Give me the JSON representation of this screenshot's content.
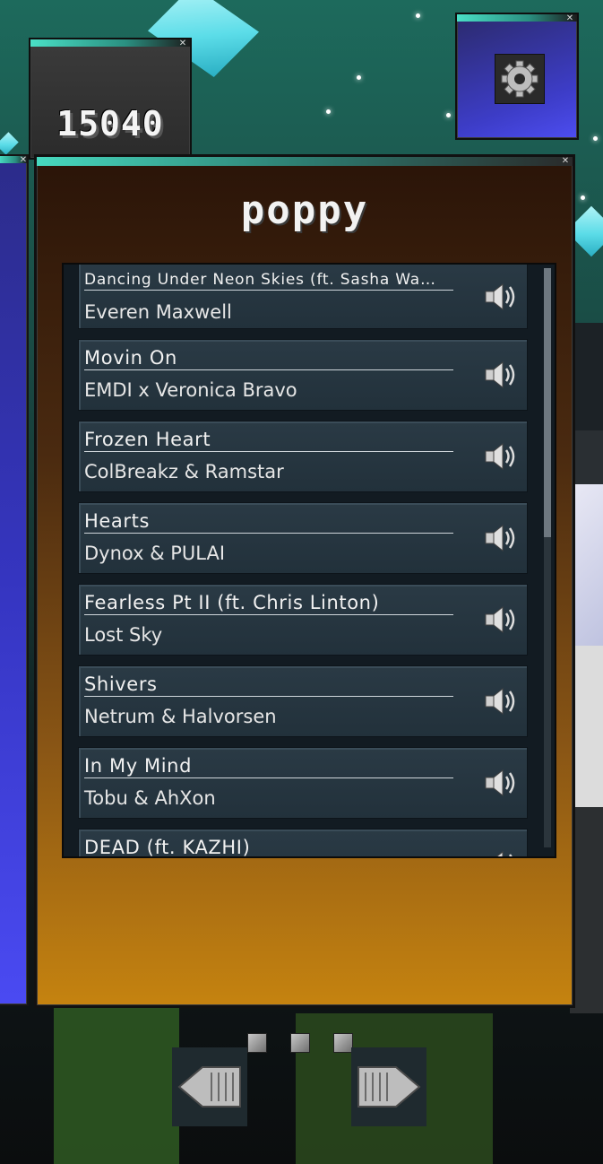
{
  "score": {
    "value": "15040"
  },
  "panel": {
    "title": "poppy"
  },
  "tracks": [
    {
      "title": "Dancing Under Neon Skies (ft. Sasha Wa…",
      "artist": "Everen Maxwell"
    },
    {
      "title": "Movin On",
      "artist": "EMDI x Veronica Bravo"
    },
    {
      "title": "Frozen Heart",
      "artist": "ColBreakz & Ramstar"
    },
    {
      "title": "Hearts",
      "artist": "Dynox & PULAI"
    },
    {
      "title": "Fearless Pt II (ft. Chris Linton)",
      "artist": "Lost Sky"
    },
    {
      "title": "Shivers",
      "artist": "Netrum & Halvorsen"
    },
    {
      "title": "In My Mind",
      "artist": "Tobu & AhXon"
    },
    {
      "title": "DEAD (ft. KAZHI)",
      "artist": ""
    }
  ],
  "icons": {
    "settings": "gear-icon",
    "track_preview": "speaker-icon",
    "prev": "arrow-left-icon",
    "next": "arrow-right-icon",
    "window_close": "close-icon"
  },
  "colors": {
    "window_accent": "#4ae0c6",
    "panel_bottom": "#c58310",
    "track_bg": "#22313b"
  }
}
